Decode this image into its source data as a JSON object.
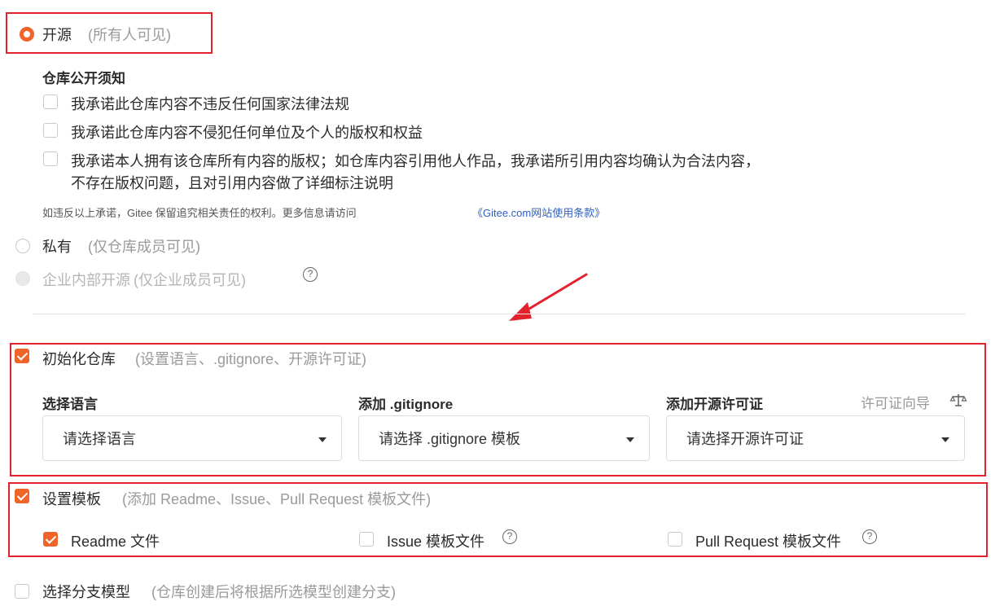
{
  "visibility": {
    "open": {
      "label": "开源",
      "hint": "(所有人可见)",
      "notice_title": "仓库公开须知",
      "promises": [
        "我承诺此仓库内容不违反任何国家法律法规",
        "我承诺此仓库内容不侵犯任何单位及个人的版权和权益",
        "我承诺本人拥有该仓库所有内容的版权；如仓库内容引用他人作品，我承诺所引用内容均确认为合法内容，",
        "不存在版权问题，且对引用内容做了详细标注说明"
      ],
      "footnote": {
        "text": "如违反以上承诺，Gitee 保留追究相关责任的权利。更多信息请访问",
        "link": "《Gitee.com网站使用条款》"
      }
    },
    "private": {
      "label": "私有",
      "hint": "(仅仓库成员可见)"
    },
    "enterprise": {
      "label": "企业内部开源",
      "hint": "(仅企业成员可见)",
      "help_glyph": "?"
    }
  },
  "init_repo": {
    "label": "初始化仓库",
    "hint": "(设置语言、.gitignore、开源许可证)",
    "fields": {
      "language": {
        "label": "选择语言",
        "placeholder": "请选择语言"
      },
      "gitignore": {
        "label": "添加 .gitignore",
        "placeholder": "请选择 .gitignore 模板"
      },
      "license": {
        "label": "添加开源许可证",
        "placeholder": "请选择开源许可证",
        "wizard_link": "许可证向导"
      }
    }
  },
  "template": {
    "label": "设置模板",
    "hint": "(添加 Readme、Issue、Pull Request 模板文件)",
    "options": [
      {
        "label": "Readme 文件",
        "checked": true
      },
      {
        "label": "Issue 模板文件",
        "checked": false,
        "help_glyph": "?"
      },
      {
        "label": "Pull Request 模板文件",
        "checked": false,
        "help_glyph": "?"
      }
    ]
  },
  "branch_model": {
    "label": "选择分支模型",
    "hint": "(仓库创建后将根据所选模型创建分支)"
  },
  "colors": {
    "accent": "#f0642a",
    "highlight_border": "#e3222d",
    "link": "#2f5fbf"
  },
  "icons": {
    "license_wizard": "scales-icon",
    "help": "question-circle-icon",
    "caret": "caret-down-icon"
  }
}
